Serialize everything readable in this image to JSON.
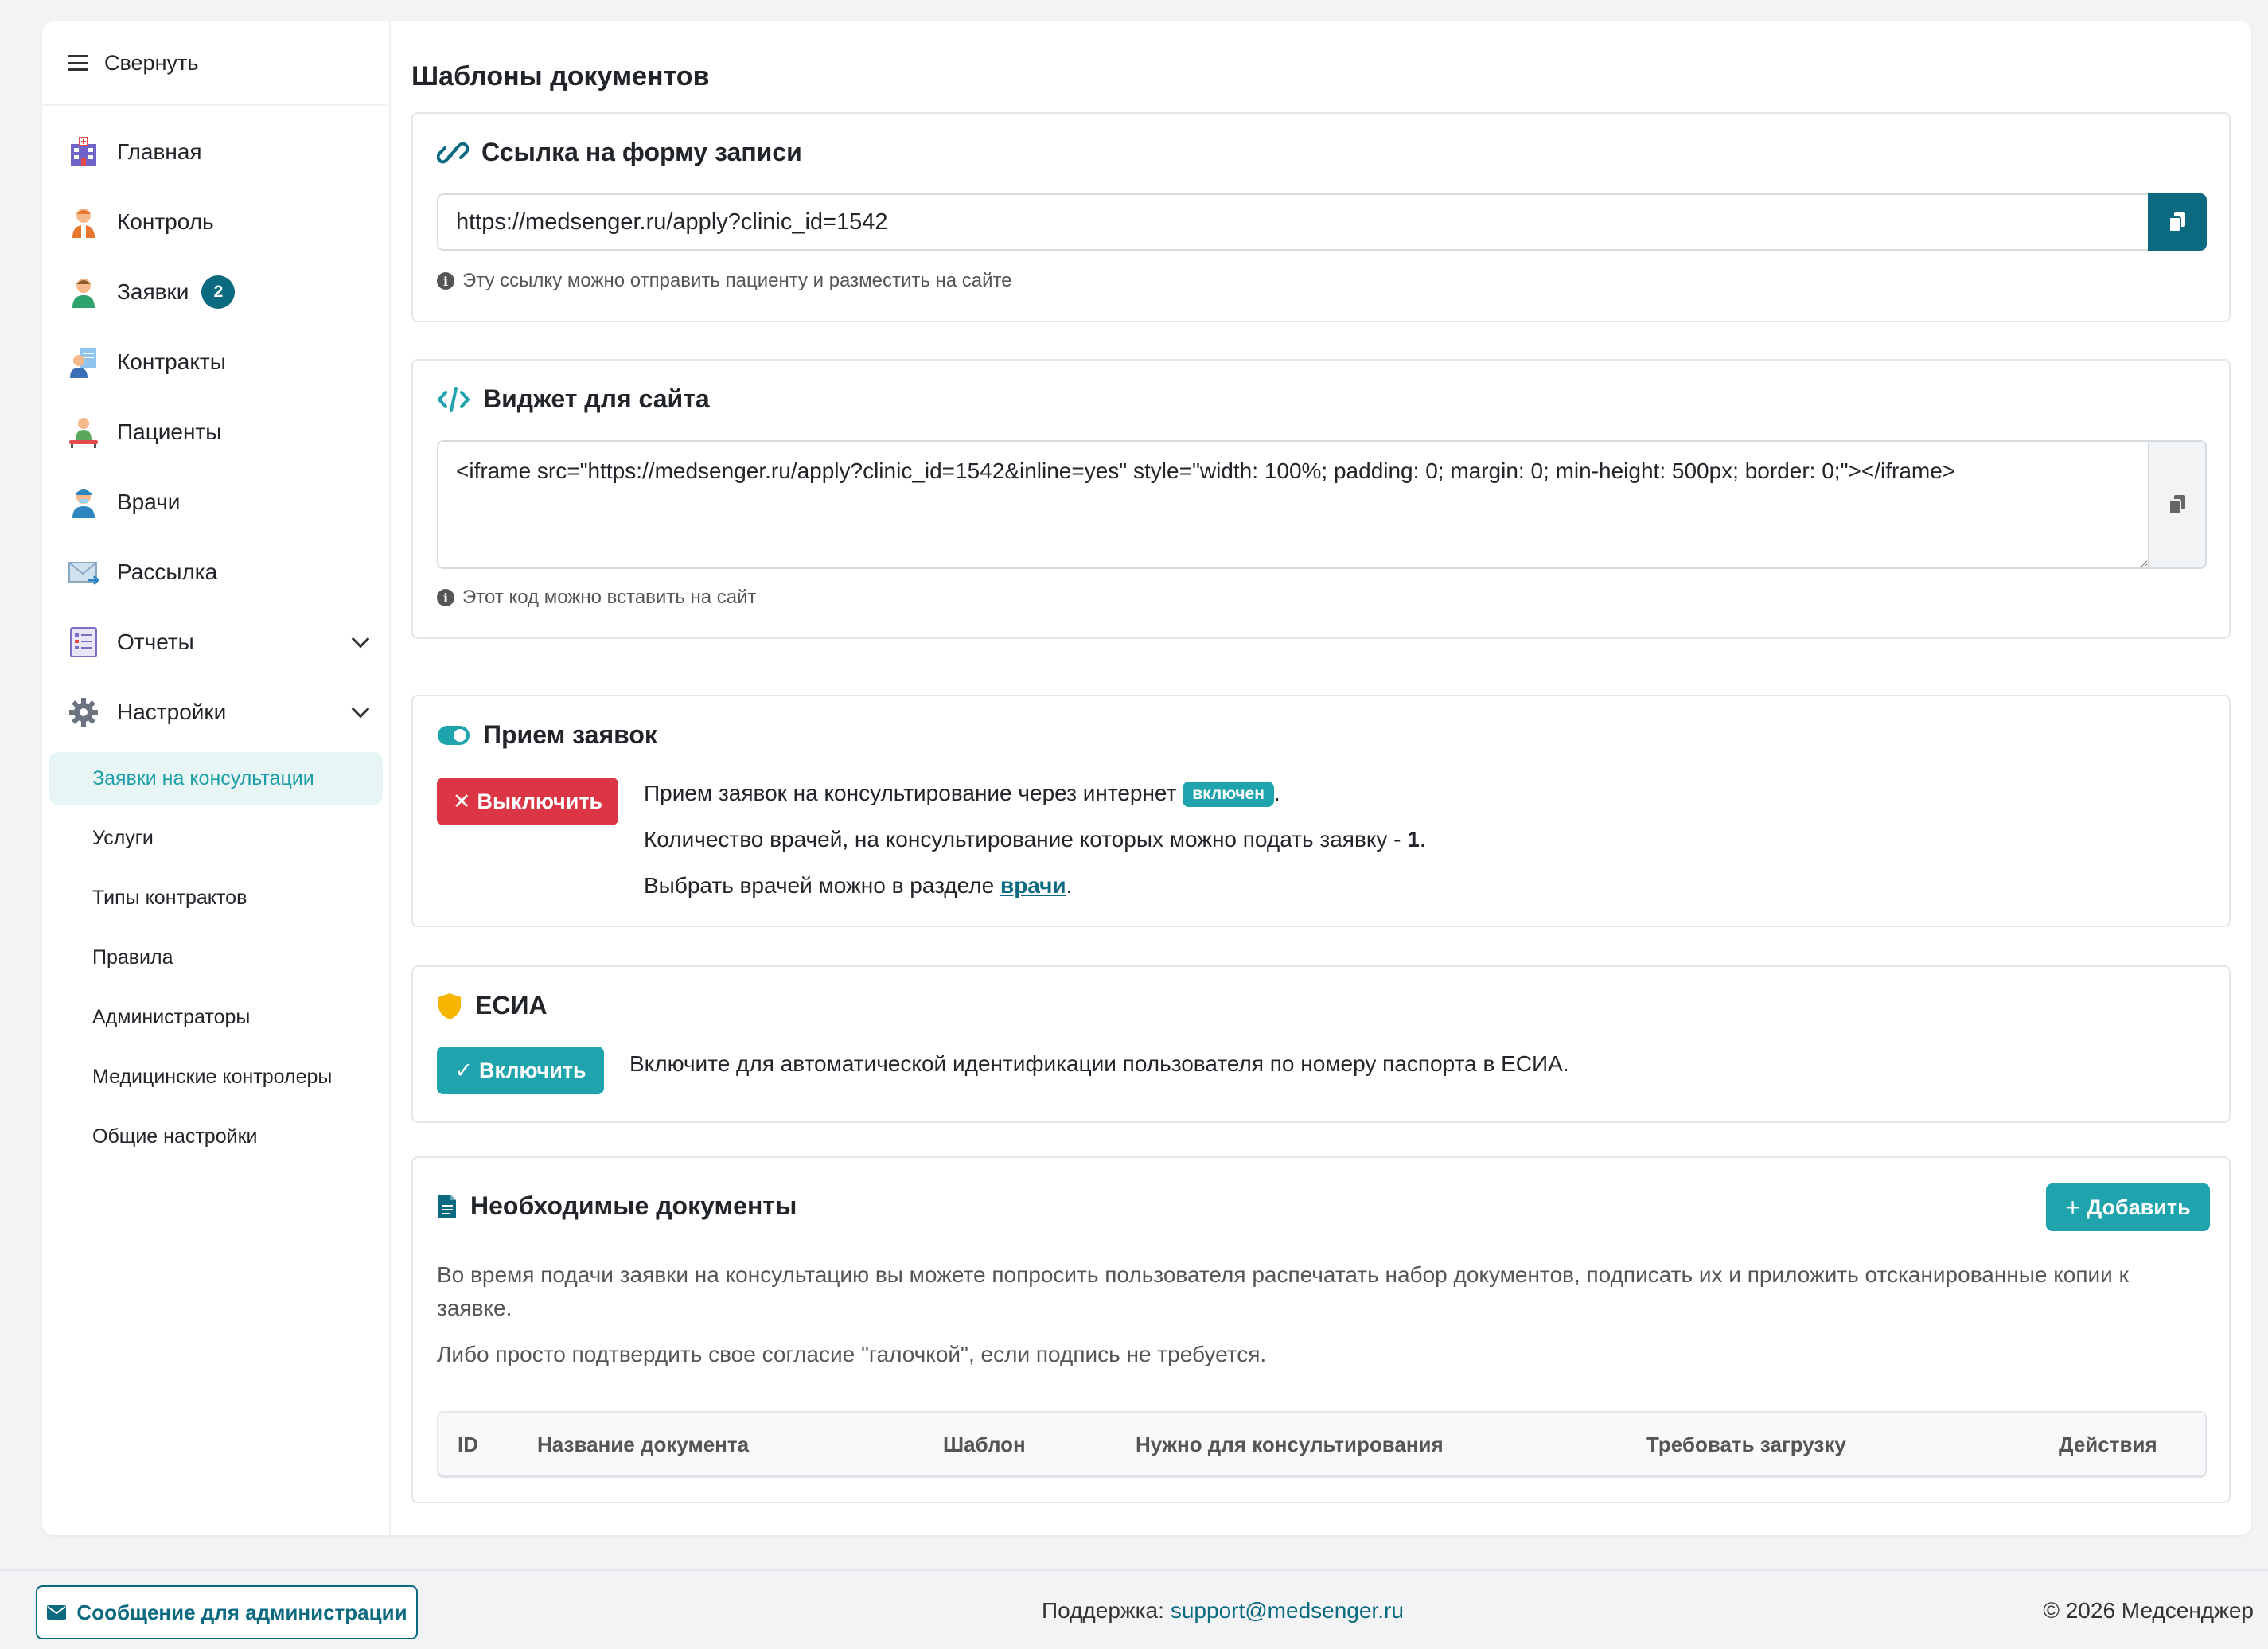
{
  "sidebar": {
    "collapse_label": "Свернуть",
    "items": [
      {
        "label": "Главная",
        "icon": "hospital-icon"
      },
      {
        "label": "Контроль",
        "icon": "doctor-icon"
      },
      {
        "label": "Заявки",
        "icon": "user-icon",
        "badge": "2"
      },
      {
        "label": "Контракты",
        "icon": "contract-icon"
      },
      {
        "label": "Пациенты",
        "icon": "patient-icon"
      },
      {
        "label": "Врачи",
        "icon": "physician-icon"
      },
      {
        "label": "Рассылка",
        "icon": "mail-icon"
      },
      {
        "label": "Отчеты",
        "icon": "report-icon"
      },
      {
        "label": "Настройки",
        "icon": "gear-icon"
      }
    ],
    "settings_sub": [
      {
        "label": "Заявки на консультации",
        "active": true
      },
      {
        "label": "Услуги"
      },
      {
        "label": "Типы контрактов"
      },
      {
        "label": "Правила"
      },
      {
        "label": "Администраторы"
      },
      {
        "label": "Медицинские контролеры"
      },
      {
        "label": "Общие настройки"
      }
    ]
  },
  "page": {
    "title": "Шаблоны документов"
  },
  "link_card": {
    "title": "Ссылка на форму записи",
    "url": "https://medsenger.ru/apply?clinic_id=1542",
    "hint": "Эту ссылку можно отправить пациенту и разместить на сайте"
  },
  "widget_card": {
    "title": "Виджет для сайта",
    "code": "<iframe src=\"https://medsenger.ru/apply?clinic_id=1542&inline=yes\" style=\"width: 100%; padding: 0; margin: 0; min-height: 500px; border: 0;\"></iframe>",
    "hint": "Этот код можно вставить на сайт"
  },
  "requests_card": {
    "title": "Прием заявок",
    "button": "Выключить",
    "line1": "Прием заявок на консультирование через интернет",
    "status_pill": "включен",
    "line2_prefix": "Количество врачей, на консультирование которых можно подать заявку - ",
    "line2_count": "1",
    "line3_prefix": "Выбрать врачей можно в разделе ",
    "line3_link": "врачи"
  },
  "esia_card": {
    "title": "ЕСИА",
    "button": "Включить",
    "text": "Включите для автоматической идентификации пользователя по номеру паспорта в ЕСИА."
  },
  "docs_card": {
    "title": "Необходимые документы",
    "add_button": "Добавить",
    "para1": "Во время подачи заявки на консультацию вы можете попросить пользователя распечатать набор документов, подписать их и приложить отсканированные копии к заявке.",
    "para2": "Либо просто подтвердить свое согласие \"галочкой\", если подпись не требуется.",
    "columns": [
      "ID",
      "Название документа",
      "Шаблон",
      "Нужно для консультирования",
      "Требовать загрузку",
      "Действия"
    ]
  },
  "footer": {
    "admin_message": "Сообщение для администрации",
    "support_label": "Поддержка:",
    "support_email": "support@medsenger.ru",
    "copyright": "© 2026 Медсенджер"
  },
  "colors": {
    "primary": "#0b6a80",
    "accent": "#1fa4ae",
    "danger": "#dc3545",
    "warning": "#f7b500"
  }
}
